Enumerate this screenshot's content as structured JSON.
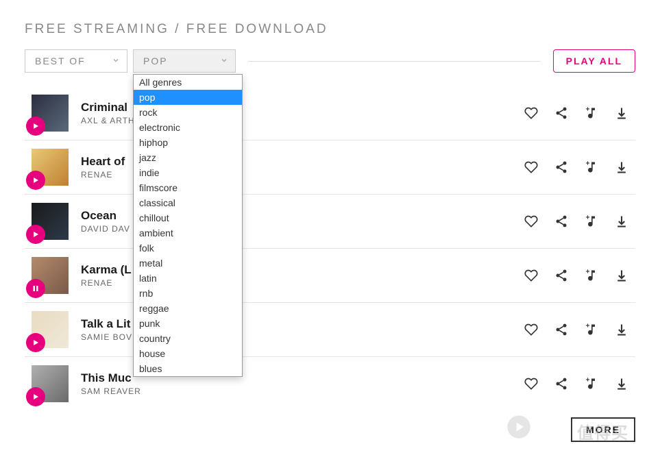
{
  "header": {
    "title": "FREE STREAMING / FREE DOWNLOAD"
  },
  "filters": {
    "sort": {
      "label": "BEST OF"
    },
    "genre": {
      "label": "POP",
      "selected_index": 1,
      "options": [
        "All genres",
        "pop",
        "rock",
        "electronic",
        "hiphop",
        "jazz",
        "indie",
        "filmscore",
        "classical",
        "chillout",
        "ambient",
        "folk",
        "metal",
        "latin",
        "rnb",
        "reggae",
        "punk",
        "country",
        "house",
        "blues"
      ]
    }
  },
  "play_all": {
    "label": "PLAY ALL"
  },
  "tracks": [
    {
      "title": "Criminal",
      "artist": "AXL & ARTH",
      "state": "play",
      "art": {
        "from": "#2b2e40",
        "to": "#5a6a7a"
      }
    },
    {
      "title": "Heart of",
      "artist": "RENAE",
      "state": "play",
      "art": {
        "from": "#e8c978",
        "to": "#c08030"
      }
    },
    {
      "title": "Ocean",
      "artist": "DAVID DAV",
      "state": "play",
      "art": {
        "from": "#1a1a1a",
        "to": "#2d3a4a"
      }
    },
    {
      "title": "Karma (L",
      "artist": "RENAE",
      "state": "pause",
      "art": {
        "from": "#b48a6a",
        "to": "#7a5a4a"
      }
    },
    {
      "title": "Talk a Lit",
      "artist": "SAMIE BOV",
      "state": "play",
      "art": {
        "from": "#e8dcc0",
        "to": "#f0e8d8"
      }
    },
    {
      "title": "This Muc",
      "artist": "SAM REAVER",
      "state": "play",
      "art": {
        "from": "#b0b0b0",
        "to": "#6a6a6a"
      }
    }
  ],
  "action_icons": {
    "like": "heart-icon",
    "share": "share-icon",
    "addplaylist": "add-playlist-icon",
    "download": "download-icon"
  },
  "footer": {
    "more_label": "MORE",
    "watermark": "值得买"
  }
}
